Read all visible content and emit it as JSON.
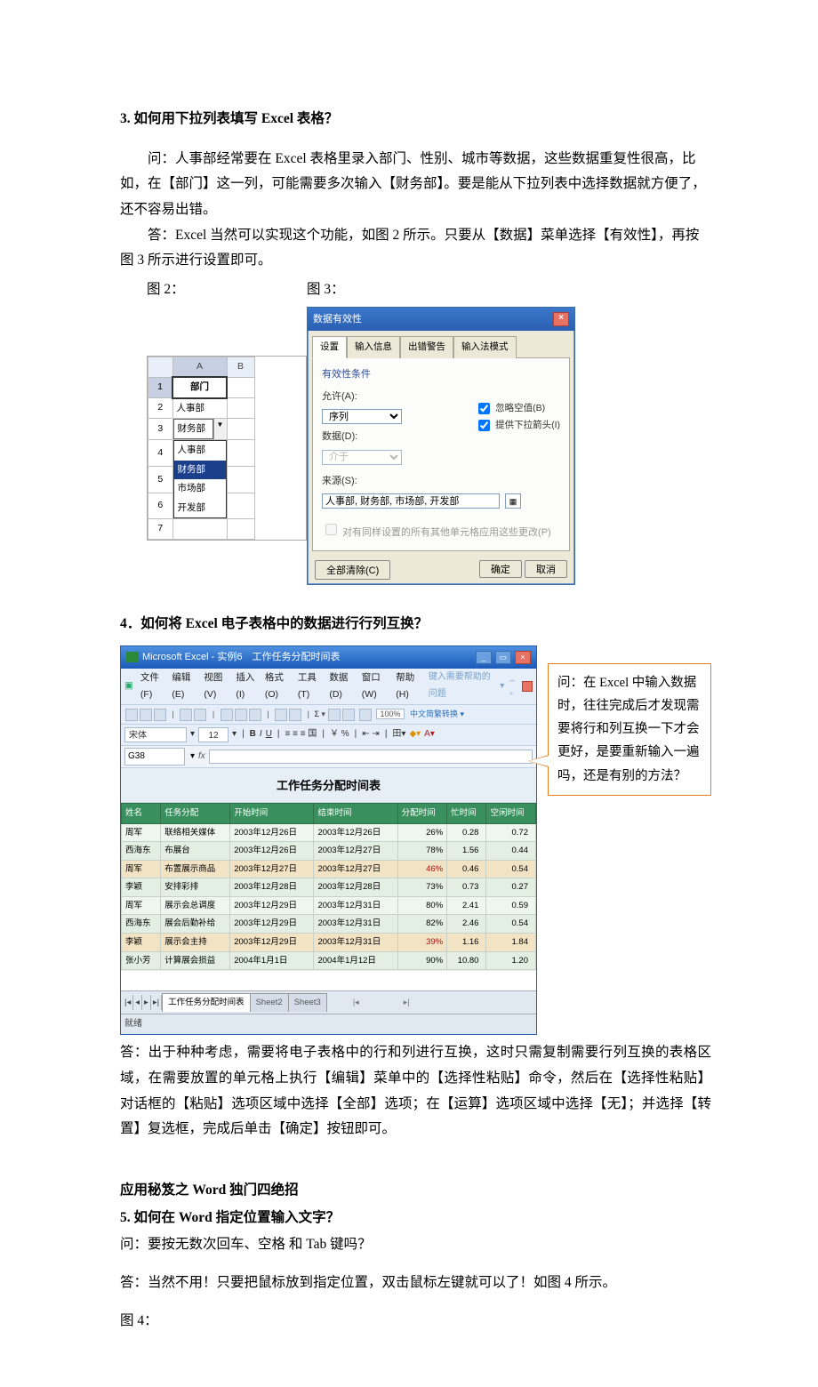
{
  "section3": {
    "heading": "3.  如何用下拉列表填写 Excel 表格？",
    "q": "问：人事部经常要在 Excel 表格里录入部门、性别、城市等数据，这些数据重复性很高，比如，在【部门】这一列，可能需要多次输入【财务部】。要是能从下拉列表中选择数据就方便了，还不容易出错。",
    "a": "答：Excel 当然可以实现这个功能，如图 2 所示。只要从【数据】菜单选择【有效性】，再按图 3 所示进行设置即可。",
    "fig2_label": "图 2：",
    "fig3_label": "图 3："
  },
  "mini_sheet": {
    "col_a": "A",
    "col_b": "B",
    "header_cell": "部门",
    "row2": "人事部",
    "row3": "财务部",
    "dd_items": [
      "人事部",
      "财务部",
      "市场部",
      "开发部"
    ],
    "dd_selected_index": 1
  },
  "dialog": {
    "title": "数据有效性",
    "tabs": [
      "设置",
      "输入信息",
      "出错警告",
      "输入法模式"
    ],
    "group_label": "有效性条件",
    "allow_label": "允许(A):",
    "allow_value": "序列",
    "data_label": "数据(D):",
    "data_value": "介于",
    "source_label": "来源(S):",
    "source_value": "人事部, 财务部, 市场部, 开发部",
    "cb_ignore": "忽略空值(B)",
    "cb_dropdown": "提供下拉箭头(I)",
    "cb_apply": "对有同样设置的所有其他单元格应用这些更改(P)",
    "btn_clear": "全部清除(C)",
    "btn_ok": "确定",
    "btn_cancel": "取消"
  },
  "section4": {
    "heading": "4．如何将 Excel 电子表格中的数据进行行列互换？",
    "callout": "问：在 Excel 中输入数据时，往往完成后才发现需要将行和列互换一下才会更好，是要重新输入一遍吗，还是有别的方法？",
    "answer": "答：出于种种考虑，需要将电子表格中的行和列进行互换，这时只需复制需要行列互换的表格区域，在需要放置的单元格上执行【编辑】菜单中的【选择性粘贴】命令，然后在【选择性粘贴】对话框的【粘贴】选项区域中选择【全部】选项；在【运算】选项区域中选择【无】；并选择【转置】复选框，完成后单击【确定】按钮即可。"
  },
  "excel": {
    "title": "Microsoft Excel - 实例6　工作任务分配时间表",
    "menu": [
      "文件(F)",
      "编辑(E)",
      "视图(V)",
      "插入(I)",
      "格式(O)",
      "工具(T)",
      "数据(D)",
      "窗口(W)",
      "帮助(H)"
    ],
    "help_prompt": "键入需要帮助的问题",
    "font_name": "宋体",
    "font_size": "12",
    "zoom": "100%",
    "cn_convert": "中文简繁转换 ▾",
    "namebox": "G38",
    "sheet_title": "工作任务分配时间表",
    "headers": [
      "姓名",
      "任务分配",
      "开始时间",
      "结束时间",
      "分配时间",
      "忙时间",
      "空闲时间"
    ],
    "rows": [
      {
        "c": [
          "周军",
          "联络相关媒体",
          "2003年12月26日",
          "2003年12月26日",
          "26%",
          "0.28",
          "0.72"
        ]
      },
      {
        "c": [
          "西海东",
          "布展台",
          "2003年12月26日",
          "2003年12月27日",
          "78%",
          "1.56",
          "0.44"
        ]
      },
      {
        "c": [
          "周军",
          "布置展示商品",
          "2003年12月27日",
          "2003年12月27日",
          "46%",
          "0.46",
          "0.54"
        ]
      },
      {
        "c": [
          "李颖",
          "安排彩排",
          "2003年12月28日",
          "2003年12月28日",
          "73%",
          "0.73",
          "0.27"
        ]
      },
      {
        "c": [
          "周军",
          "展示会总调度",
          "2003年12月29日",
          "2003年12月31日",
          "80%",
          "2.41",
          "0.59"
        ]
      },
      {
        "c": [
          "西海东",
          "展会后勤补给",
          "2003年12月29日",
          "2003年12月31日",
          "82%",
          "2.46",
          "0.54"
        ]
      },
      {
        "c": [
          "李颖",
          "展示会主持",
          "2003年12月29日",
          "2003年12月31日",
          "39%",
          "1.16",
          "1.84"
        ]
      },
      {
        "c": [
          "张小芳",
          "计算展会损益",
          "2004年1月1日",
          "2004年1月12日",
          "90%",
          "10.80",
          "1.20"
        ]
      }
    ],
    "tabs": [
      "工作任务分配时间表",
      "Sheet2",
      "Sheet3"
    ],
    "status": "就绪"
  },
  "section5": {
    "pre": "应用秘笈之 Word 独门四绝招",
    "heading": "5.  如何在 Word 指定位置输入文字？",
    "q": "问：要按无数次回车、空格 和 Tab 键吗？",
    "a": "答：当然不用！只要把鼠标放到指定位置，双击鼠标左键就可以了！如图 4 所示。",
    "fig4": "图 4："
  }
}
